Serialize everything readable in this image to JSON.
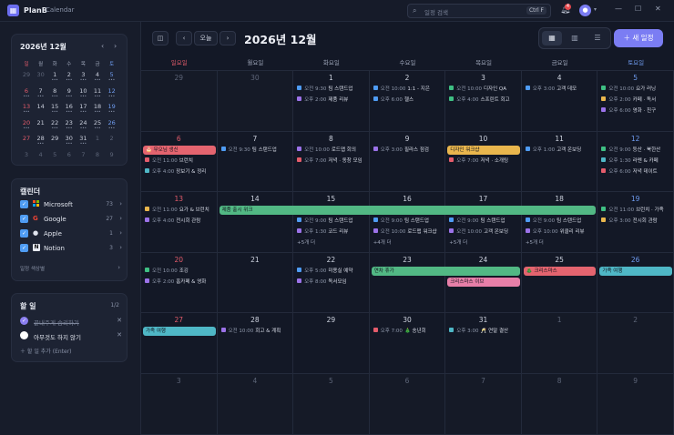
{
  "app": {
    "name": "PlanB",
    "section": "Calendar"
  },
  "search": {
    "placeholder": "일정 검색",
    "shortcut": "Ctrl F"
  },
  "notifications": {
    "count": "4"
  },
  "sidebar": {
    "mini": {
      "title": "2026년 12월",
      "weekdays": [
        "일",
        "월",
        "화",
        "수",
        "목",
        "금",
        "토"
      ],
      "rows": [
        [
          "29",
          "30",
          "1",
          "2",
          "3",
          "4",
          "5"
        ],
        [
          "6",
          "7",
          "8",
          "9",
          "10",
          "11",
          "12"
        ],
        [
          "13",
          "14",
          "15",
          "16",
          "17",
          "18",
          "19"
        ],
        [
          "20",
          "21",
          "22",
          "23",
          "24",
          "25",
          "26"
        ],
        [
          "27",
          "28",
          "29",
          "30",
          "31",
          "1",
          "2"
        ],
        [
          "3",
          "4",
          "5",
          "6",
          "7",
          "8",
          "9"
        ]
      ]
    },
    "calendars": {
      "title": "캘린더",
      "items": [
        {
          "name": "Microsoft",
          "count": "73"
        },
        {
          "name": "Google",
          "count": "27"
        },
        {
          "name": "Apple",
          "count": "1"
        },
        {
          "name": "Notion",
          "count": "3"
        }
      ],
      "settings": "일정 색상별"
    },
    "todos": {
      "title": "할 일",
      "count": "1/2",
      "items": [
        {
          "text": "끝내주게 승리하기",
          "done": true
        },
        {
          "text": "아무것도 하지 않기",
          "done": false
        }
      ],
      "add": "할 일 추가 (Enter)"
    }
  },
  "toolbar": {
    "today": "오늘",
    "title": "2026년 12월",
    "new_event": "새 일정"
  },
  "calendar": {
    "weekdays": [
      "일요일",
      "월요일",
      "화요일",
      "수요일",
      "목요일",
      "금요일",
      "토요일"
    ],
    "weeks": [
      [
        {
          "d": "29",
          "dim": true,
          "ev": []
        },
        {
          "d": "30",
          "dim": true,
          "ev": []
        },
        {
          "d": "1",
          "ev": [
            {
              "t": "오전 9:30",
              "n": "팀 스탠드업",
              "c": "#4f9cf3"
            },
            {
              "t": "오후 2:00",
              "n": "제품 리뷰",
              "c": "#9b72e8"
            }
          ]
        },
        {
          "d": "2",
          "ev": [
            {
              "t": "오전 10:00",
              "n": "1:1 - 지은",
              "c": "#4f9cf3"
            },
            {
              "t": "오후 6:00",
              "n": "헬스",
              "c": "#4f9cf3"
            }
          ]
        },
        {
          "d": "3",
          "ev": [
            {
              "t": "오전 10:00",
              "n": "디자인 QA",
              "c": "#3fbf83"
            },
            {
              "t": "오후 4:00",
              "n": "스프린트 회고",
              "c": "#3fbf83"
            }
          ]
        },
        {
          "d": "4",
          "ev": [
            {
              "t": "오후 3:00",
              "n": "고객 데모",
              "c": "#4f9cf3"
            }
          ]
        },
        {
          "d": "5",
          "ev": [
            {
              "t": "오전 10:00",
              "n": "요가 러닝",
              "c": "#3fbf83"
            },
            {
              "t": "오후 2:00",
              "n": "카페 · 독서",
              "c": "#e9b64d"
            },
            {
              "t": "오후 6:00",
              "n": "영화 · 친구",
              "c": "#9b72e8"
            }
          ]
        }
      ],
      [
        {
          "d": "6",
          "ev": [
            {
              "t": "오전 11:00",
              "n": "브런치",
              "c": "#e45c6b"
            },
            {
              "t": "오후 4:00",
              "n": "장보기 & 정리",
              "c": "#4fb7c6"
            }
          ]
        },
        {
          "d": "7",
          "ev": [
            {
              "t": "오전 9:30",
              "n": "팀 스탠드업",
              "c": "#4f9cf3"
            }
          ]
        },
        {
          "d": "8",
          "ev": [
            {
              "t": "오전 10:00",
              "n": "로드맵 회의",
              "c": "#9b72e8"
            },
            {
              "t": "오후 7:00",
              "n": "저녁 · 동창 모임",
              "c": "#e45c6b"
            }
          ]
        },
        {
          "d": "9",
          "ev": [
            {
              "t": "오후 3:00",
              "n": "필라스 점검",
              "c": "#9b72e8"
            }
          ]
        },
        {
          "d": "10",
          "ev": [
            {
              "t": "오후 7:00",
              "n": "저녁 · 소개팅",
              "c": "#e45c6b"
            }
          ]
        },
        {
          "d": "11",
          "ev": [
            {
              "t": "오후 1:00",
              "n": "고객 온보딩",
              "c": "#4f9cf3"
            }
          ]
        },
        {
          "d": "12",
          "ev": [
            {
              "t": "오전 9:00",
              "n": "등산 · 북한산",
              "c": "#3fbf83"
            },
            {
              "t": "오후 1:30",
              "n": "라멘 & 카페",
              "c": "#4fb7c6"
            },
            {
              "t": "오후 6:00",
              "n": "저녁 데이트",
              "c": "#e45c6b"
            }
          ]
        }
      ],
      [
        {
          "d": "13",
          "ev": [
            {
              "t": "오전 11:00",
              "n": "요가 & 브런치",
              "c": "#e9b64d"
            },
            {
              "t": "오후 4:00",
              "n": "전시회 관람",
              "c": "#9b72e8"
            }
          ]
        },
        {
          "d": "14",
          "ev": []
        },
        {
          "d": "15",
          "ev": [
            {
              "t": "오전 9:00",
              "n": "팀 스탠드업",
              "c": "#4f9cf3"
            },
            {
              "t": "오후 1:30",
              "n": "코드 리뷰",
              "c": "#9b72e8"
            }
          ],
          "more": "+5개 더"
        },
        {
          "d": "16",
          "ev": [
            {
              "t": "오전 9:00",
              "n": "팀 스탠드업",
              "c": "#4f9cf3"
            },
            {
              "t": "오전 10:00",
              "n": "로드맵 워크샵",
              "c": "#9b72e8"
            }
          ],
          "more": "+4개 더"
        },
        {
          "d": "17",
          "ev": [
            {
              "t": "오전 9:00",
              "n": "팀 스탠드업",
              "c": "#4f9cf3"
            },
            {
              "t": "오전 10:00",
              "n": "고객 온보딩",
              "c": "#9b72e8"
            }
          ],
          "more": "+5개 더"
        },
        {
          "d": "18",
          "ev": [
            {
              "t": "오전 9:00",
              "n": "팀 스탠드업",
              "c": "#4f9cf3"
            },
            {
              "t": "오후 10:00",
              "n": "위클리 리뷰",
              "c": "#9b72e8"
            }
          ],
          "more": "+5개 더"
        },
        {
          "d": "19",
          "ev": [
            {
              "t": "오전 11:00",
              "n": "브런치 · 가족",
              "c": "#3fbf83"
            },
            {
              "t": "오후 3:00",
              "n": "전시회 관람",
              "c": "#e9b64d"
            }
          ]
        }
      ],
      [
        {
          "d": "20",
          "ev": [
            {
              "t": "오전 10:00",
              "n": "조깅",
              "c": "#3fbf83"
            },
            {
              "t": "오후 2:00",
              "n": "홈카페 & 영화",
              "c": "#9b72e8"
            }
          ]
        },
        {
          "d": "21",
          "ev": []
        },
        {
          "d": "22",
          "ev": [
            {
              "t": "오후 5:00",
              "n": "미용실 예약",
              "c": "#4f9cf3"
            },
            {
              "t": "오후 8:00",
              "n": "독서모임",
              "c": "#9b72e8"
            }
          ]
        },
        {
          "d": "23",
          "ev": []
        },
        {
          "d": "24",
          "ev": []
        },
        {
          "d": "25",
          "ev": []
        },
        {
          "d": "26",
          "ev": []
        }
      ],
      [
        {
          "d": "27",
          "ev": []
        },
        {
          "d": "28",
          "ev": [
            {
              "t": "오전 10:00",
              "n": "회고 & 계획",
              "c": "#9b72e8"
            }
          ]
        },
        {
          "d": "29",
          "ev": []
        },
        {
          "d": "30",
          "ev": [
            {
              "t": "오후 7:00",
              "n": "🎄 송년회",
              "c": "#e45c6b"
            }
          ]
        },
        {
          "d": "31",
          "ev": [
            {
              "t": "오후 3:00",
              "n": "🥂 연말 결산",
              "c": "#4fb7c6"
            }
          ]
        },
        {
          "d": "1",
          "dim": true,
          "ev": []
        },
        {
          "d": "2",
          "dim": true,
          "ev": []
        }
      ],
      [
        {
          "d": "3",
          "dim": true,
          "ev": []
        },
        {
          "d": "4",
          "dim": true,
          "ev": []
        },
        {
          "d": "5",
          "dim": true,
          "ev": []
        },
        {
          "d": "6",
          "dim": true,
          "ev": []
        },
        {
          "d": "7",
          "dim": true,
          "ev": []
        },
        {
          "d": "8",
          "dim": true,
          "ev": []
        },
        {
          "d": "9",
          "dim": true,
          "ev": []
        }
      ]
    ],
    "bars": [
      {
        "label": "🎂 무오님 생신",
        "week": 1,
        "start": 0,
        "span": 1,
        "slot": 0,
        "color": "#e4646f"
      },
      {
        "label": "디자인 워크샵",
        "week": 1,
        "start": 4,
        "span": 1,
        "slot": 0,
        "color": "#e9b64d"
      },
      {
        "label": "제품 출시 위크",
        "week": 2,
        "start": 1,
        "span": 5,
        "slot": 0,
        "color": "#52b884"
      },
      {
        "label": "연차 휴가",
        "week": 3,
        "start": 3,
        "span": 2,
        "slot": 0,
        "color": "#52b884"
      },
      {
        "label": "🎄 크리스마스",
        "week": 3,
        "start": 5,
        "span": 1,
        "slot": 0,
        "color": "#e4646f"
      },
      {
        "label": "가족 여행",
        "week": 3,
        "start": 6,
        "span": 1,
        "slot": 0,
        "color": "#4fb7c6"
      },
      {
        "label": "크리스마스 이브",
        "week": 3,
        "start": 4,
        "span": 1,
        "slot": 1,
        "color": "#e77fa8"
      },
      {
        "label": "가족 여행",
        "week": 4,
        "start": 0,
        "span": 1,
        "slot": 0,
        "color": "#4fb7c6"
      }
    ]
  }
}
